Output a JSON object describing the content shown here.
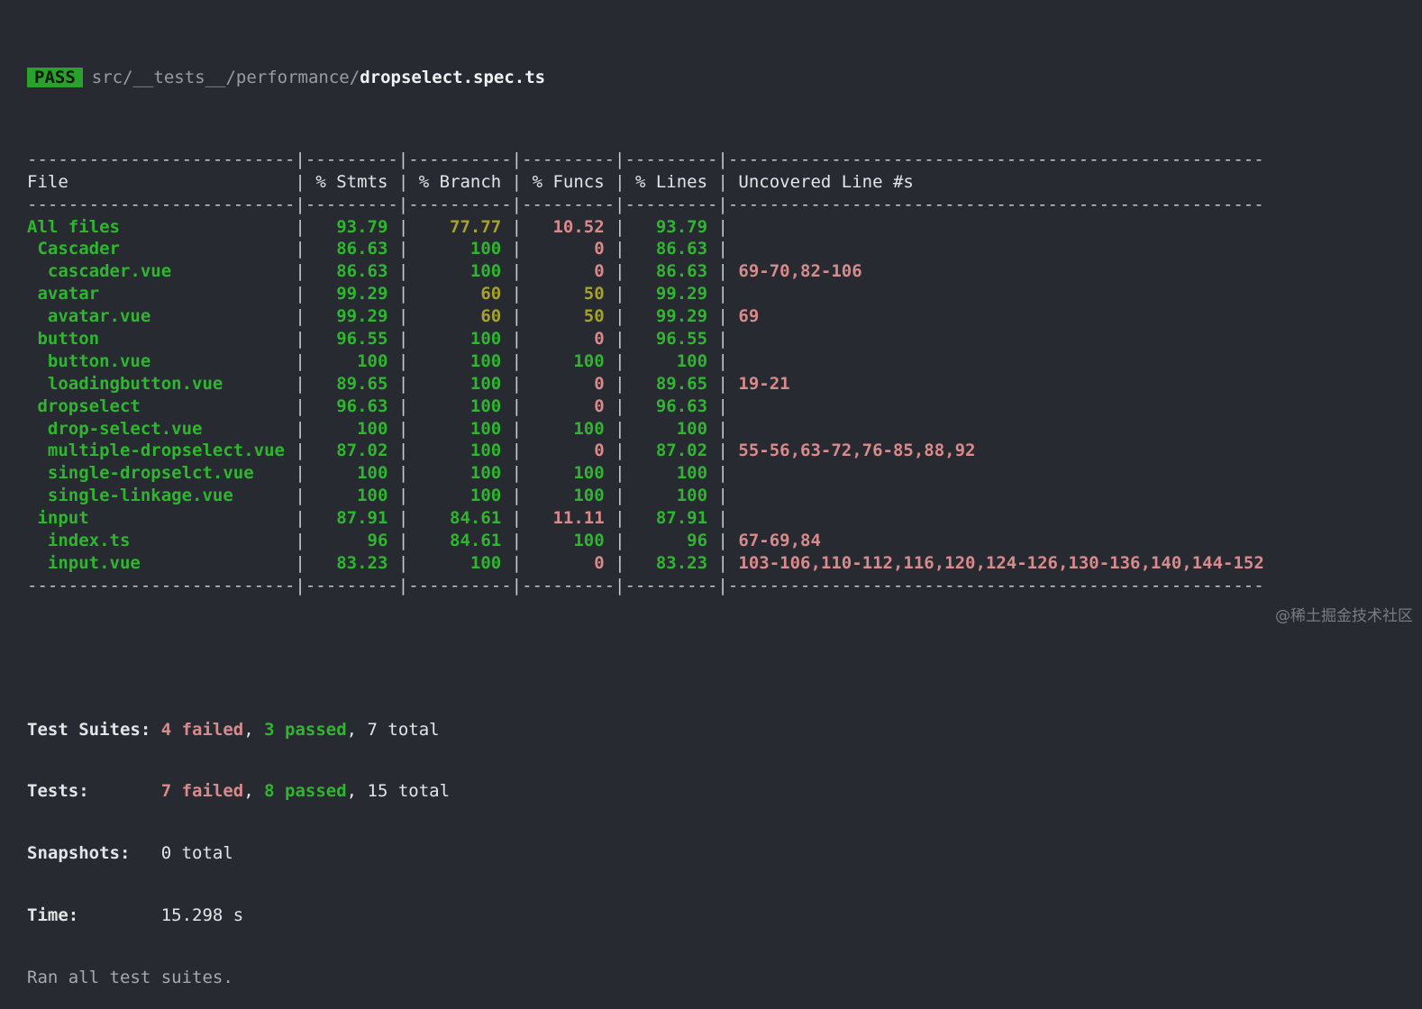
{
  "status": {
    "badge": "PASS",
    "path_prefix": "src/__tests__/performance/",
    "path_file": "dropselect.spec.ts"
  },
  "table": {
    "headers": {
      "file": "File",
      "stmts": "% Stmts",
      "branch": "% Branch",
      "funcs": "% Funcs",
      "lines": "% Lines",
      "uncovered": "Uncovered Line #s"
    },
    "rows": [
      {
        "file": "All files",
        "stmts": "93.79",
        "branch": "77.77",
        "funcs": "10.52",
        "lines": "93.79",
        "uncovered": ""
      },
      {
        "file": " Cascader",
        "stmts": "86.63",
        "branch": "100",
        "funcs": "0",
        "lines": "86.63",
        "uncovered": ""
      },
      {
        "file": "  cascader.vue",
        "stmts": "86.63",
        "branch": "100",
        "funcs": "0",
        "lines": "86.63",
        "uncovered": "69-70,82-106"
      },
      {
        "file": " avatar",
        "stmts": "99.29",
        "branch": "60",
        "funcs": "50",
        "lines": "99.29",
        "uncovered": ""
      },
      {
        "file": "  avatar.vue",
        "stmts": "99.29",
        "branch": "60",
        "funcs": "50",
        "lines": "99.29",
        "uncovered": "69"
      },
      {
        "file": " button",
        "stmts": "96.55",
        "branch": "100",
        "funcs": "0",
        "lines": "96.55",
        "uncovered": ""
      },
      {
        "file": "  button.vue",
        "stmts": "100",
        "branch": "100",
        "funcs": "100",
        "lines": "100",
        "uncovered": ""
      },
      {
        "file": "  loadingbutton.vue",
        "stmts": "89.65",
        "branch": "100",
        "funcs": "0",
        "lines": "89.65",
        "uncovered": "19-21"
      },
      {
        "file": " dropselect",
        "stmts": "96.63",
        "branch": "100",
        "funcs": "0",
        "lines": "96.63",
        "uncovered": ""
      },
      {
        "file": "  drop-select.vue",
        "stmts": "100",
        "branch": "100",
        "funcs": "100",
        "lines": "100",
        "uncovered": ""
      },
      {
        "file": "  multiple-dropselect.vue",
        "stmts": "87.02",
        "branch": "100",
        "funcs": "0",
        "lines": "87.02",
        "uncovered": "55-56,63-72,76-85,88,92"
      },
      {
        "file": "  single-dropselct.vue",
        "stmts": "100",
        "branch": "100",
        "funcs": "100",
        "lines": "100",
        "uncovered": ""
      },
      {
        "file": "  single-linkage.vue",
        "stmts": "100",
        "branch": "100",
        "funcs": "100",
        "lines": "100",
        "uncovered": ""
      },
      {
        "file": " input",
        "stmts": "87.91",
        "branch": "84.61",
        "funcs": "11.11",
        "lines": "87.91",
        "uncovered": ""
      },
      {
        "file": "  index.ts",
        "stmts": "96",
        "branch": "84.61",
        "funcs": "100",
        "lines": "96",
        "uncovered": "67-69,84"
      },
      {
        "file": "  input.vue",
        "stmts": "83.23",
        "branch": "100",
        "funcs": "0",
        "lines": "83.23",
        "uncovered": "103-106,110-112,116,120,124-126,130-136,140,144-152"
      }
    ]
  },
  "summary": {
    "suites_label": "Test Suites:",
    "suites_failed": "4 failed",
    "suites_passed": "3 passed",
    "suites_total": "7 total",
    "tests_label": "Tests:",
    "tests_failed": "7 failed",
    "tests_passed": "8 passed",
    "tests_total": "15 total",
    "snapshots_label": "Snapshots:",
    "snapshots_value": "0 total",
    "time_label": "Time:",
    "time_value": "15.298 s",
    "footer": "Ran all test suites."
  },
  "watermark": "@稀土掘金技术社区",
  "colors": {
    "background": "#282a32",
    "pass_badge": "#2aa12b",
    "high": "#2fb62f",
    "medium": "#a6a22a",
    "low": "#d98a8a"
  }
}
